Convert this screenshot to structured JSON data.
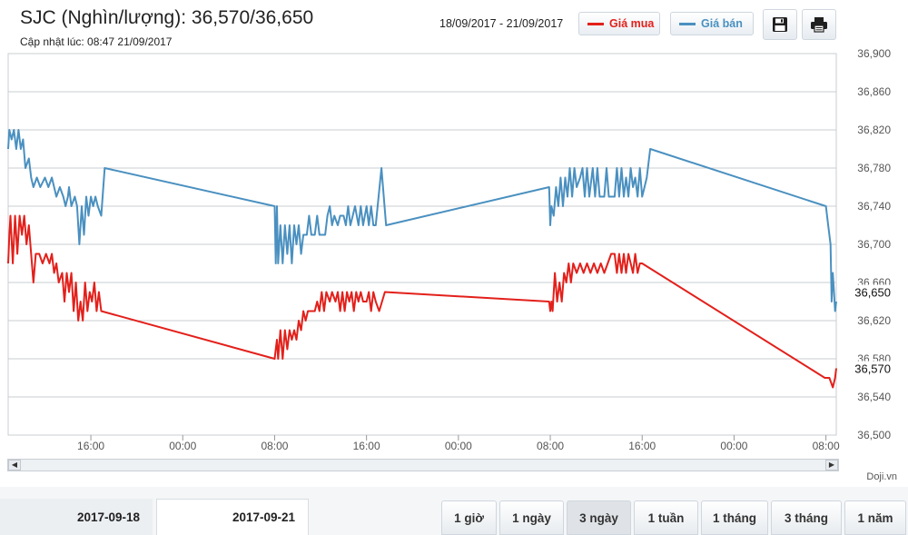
{
  "header": {
    "title": "SJC (Nghìn/lượng): 36,570/36,650",
    "updated": "Cập nhật lúc: 08:47 21/09/2017",
    "range": "18/09/2017 - 21/09/2017",
    "legend_buy": "Giá mua",
    "legend_sell": "Giá bán",
    "save_icon": "save-icon",
    "print_icon": "print-icon"
  },
  "colors": {
    "buy": "#e3201b",
    "sell": "#4a90c0"
  },
  "footer": {
    "credit": "Doji.vn"
  },
  "tabs": {
    "date1": "2017-09-18",
    "date2": "2017-09-21"
  },
  "ranges": [
    "1 giờ",
    "1 ngày",
    "3 ngày",
    "1 tuần",
    "1 tháng",
    "3 tháng",
    "1 năm"
  ],
  "active_range": "3 ngày",
  "chart_data": {
    "type": "line",
    "title": "",
    "xlabel": "",
    "ylabel": "",
    "ylim": [
      36500,
      36900
    ],
    "yticks": [
      "36,900",
      "36,860",
      "36,820",
      "36,780",
      "36,740",
      "36,700",
      "36,660",
      "36,620",
      "36,580",
      "36,540",
      "36,500"
    ],
    "xticks": [
      {
        "label": "16:00",
        "h": 16
      },
      {
        "label": "00:00",
        "h": 24
      },
      {
        "label": "08:00",
        "h": 32
      },
      {
        "label": "16:00",
        "h": 40
      },
      {
        "label": "00:00",
        "h": 48
      },
      {
        "label": "08:00",
        "h": 56
      },
      {
        "label": "16:00",
        "h": 64
      },
      {
        "label": "00:00",
        "h": 72
      },
      {
        "label": "08:00",
        "h": 80
      }
    ],
    "xrange_hours": [
      8.8,
      80.9
    ],
    "last_labels": [
      {
        "value": 36650,
        "text": "36,650"
      },
      {
        "value": 36570,
        "text": "36,570"
      }
    ],
    "series": [
      {
        "name": "Giá bán",
        "color": "#4a90c0",
        "points": [
          [
            8.8,
            36800
          ],
          [
            8.9,
            36820
          ],
          [
            9.1,
            36810
          ],
          [
            9.3,
            36820
          ],
          [
            9.5,
            36800
          ],
          [
            9.7,
            36820
          ],
          [
            9.9,
            36800
          ],
          [
            10.1,
            36810
          ],
          [
            10.3,
            36780
          ],
          [
            10.6,
            36790
          ],
          [
            10.8,
            36770
          ],
          [
            11.0,
            36760
          ],
          [
            11.3,
            36770
          ],
          [
            11.6,
            36760
          ],
          [
            12.0,
            36770
          ],
          [
            12.3,
            36760
          ],
          [
            12.6,
            36770
          ],
          [
            12.8,
            36760
          ],
          [
            13.0,
            36750
          ],
          [
            13.3,
            36760
          ],
          [
            13.6,
            36750
          ],
          [
            13.8,
            36740
          ],
          [
            14.0,
            36750
          ],
          [
            14.1,
            36760
          ],
          [
            14.3,
            36740
          ],
          [
            14.6,
            36750
          ],
          [
            14.8,
            36740
          ],
          [
            15.0,
            36700
          ],
          [
            15.2,
            36740
          ],
          [
            15.4,
            36710
          ],
          [
            15.6,
            36750
          ],
          [
            15.8,
            36730
          ],
          [
            16.0,
            36750
          ],
          [
            16.2,
            36740
          ],
          [
            16.4,
            36750
          ],
          [
            16.6,
            36740
          ],
          [
            16.9,
            36730
          ],
          [
            17.2,
            36780
          ],
          [
            32.0,
            36740
          ],
          [
            32.1,
            36680
          ],
          [
            32.2,
            36740
          ],
          [
            32.3,
            36680
          ],
          [
            32.5,
            36720
          ],
          [
            32.7,
            36680
          ],
          [
            32.9,
            36720
          ],
          [
            33.1,
            36690
          ],
          [
            33.3,
            36720
          ],
          [
            33.5,
            36680
          ],
          [
            33.7,
            36720
          ],
          [
            33.9,
            36700
          ],
          [
            34.1,
            36720
          ],
          [
            34.3,
            36690
          ],
          [
            34.5,
            36710
          ],
          [
            34.8,
            36710
          ],
          [
            35.0,
            36730
          ],
          [
            35.2,
            36710
          ],
          [
            35.5,
            36710
          ],
          [
            35.7,
            36730
          ],
          [
            35.9,
            36710
          ],
          [
            36.1,
            36710
          ],
          [
            36.4,
            36710
          ],
          [
            36.6,
            36730
          ],
          [
            36.8,
            36740
          ],
          [
            37.0,
            36720
          ],
          [
            37.2,
            36730
          ],
          [
            37.5,
            36720
          ],
          [
            37.7,
            36730
          ],
          [
            38.0,
            36730
          ],
          [
            38.2,
            36720
          ],
          [
            38.4,
            36740
          ],
          [
            38.6,
            36720
          ],
          [
            38.8,
            36730
          ],
          [
            39.0,
            36740
          ],
          [
            39.3,
            36720
          ],
          [
            39.5,
            36740
          ],
          [
            39.7,
            36720
          ],
          [
            40.0,
            36740
          ],
          [
            40.2,
            36720
          ],
          [
            40.4,
            36740
          ],
          [
            40.6,
            36720
          ],
          [
            40.8,
            36720
          ],
          [
            41.3,
            36780
          ],
          [
            41.7,
            36720
          ],
          [
            55.9,
            36760
          ],
          [
            56.0,
            36720
          ],
          [
            56.1,
            36740
          ],
          [
            56.3,
            36730
          ],
          [
            56.5,
            36760
          ],
          [
            56.7,
            36740
          ],
          [
            56.9,
            36770
          ],
          [
            57.1,
            36740
          ],
          [
            57.3,
            36770
          ],
          [
            57.5,
            36750
          ],
          [
            57.7,
            36780
          ],
          [
            57.9,
            36750
          ],
          [
            58.1,
            36780
          ],
          [
            58.3,
            36760
          ],
          [
            58.6,
            36770
          ],
          [
            58.8,
            36780
          ],
          [
            59.0,
            36750
          ],
          [
            59.2,
            36780
          ],
          [
            59.4,
            36750
          ],
          [
            59.7,
            36780
          ],
          [
            59.9,
            36750
          ],
          [
            60.1,
            36780
          ],
          [
            60.3,
            36750
          ],
          [
            60.5,
            36750
          ],
          [
            60.7,
            36750
          ],
          [
            60.9,
            36780
          ],
          [
            61.1,
            36750
          ],
          [
            61.3,
            36750
          ],
          [
            61.6,
            36750
          ],
          [
            61.8,
            36780
          ],
          [
            62.0,
            36750
          ],
          [
            62.2,
            36780
          ],
          [
            62.4,
            36750
          ],
          [
            62.6,
            36770
          ],
          [
            62.8,
            36750
          ],
          [
            63.0,
            36780
          ],
          [
            63.2,
            36760
          ],
          [
            63.4,
            36770
          ],
          [
            63.6,
            36750
          ],
          [
            63.8,
            36780
          ],
          [
            64.0,
            36750
          ],
          [
            64.2,
            36760
          ],
          [
            64.4,
            36770
          ],
          [
            64.7,
            36800
          ],
          [
            80.0,
            36740
          ],
          [
            80.2,
            36720
          ],
          [
            80.4,
            36700
          ],
          [
            80.5,
            36640
          ],
          [
            80.6,
            36670
          ],
          [
            80.7,
            36650
          ],
          [
            80.8,
            36630
          ],
          [
            80.9,
            36640
          ]
        ]
      },
      {
        "name": "Giá mua",
        "color": "#e3201b",
        "points": [
          [
            8.8,
            36680
          ],
          [
            8.9,
            36710
          ],
          [
            9.0,
            36730
          ],
          [
            9.2,
            36680
          ],
          [
            9.4,
            36730
          ],
          [
            9.6,
            36690
          ],
          [
            9.8,
            36730
          ],
          [
            10.0,
            36710
          ],
          [
            10.2,
            36730
          ],
          [
            10.4,
            36700
          ],
          [
            10.6,
            36720
          ],
          [
            10.8,
            36690
          ],
          [
            11.0,
            36660
          ],
          [
            11.2,
            36690
          ],
          [
            11.5,
            36690
          ],
          [
            11.8,
            36680
          ],
          [
            12.1,
            36690
          ],
          [
            12.4,
            36680
          ],
          [
            12.6,
            36690
          ],
          [
            12.8,
            36670
          ],
          [
            13.0,
            36680
          ],
          [
            13.2,
            36660
          ],
          [
            13.5,
            36670
          ],
          [
            13.7,
            36640
          ],
          [
            13.9,
            36670
          ],
          [
            14.1,
            36650
          ],
          [
            14.3,
            36670
          ],
          [
            14.5,
            36630
          ],
          [
            14.7,
            36660
          ],
          [
            14.9,
            36620
          ],
          [
            15.1,
            36640
          ],
          [
            15.3,
            36620
          ],
          [
            15.5,
            36660
          ],
          [
            15.7,
            36630
          ],
          [
            15.9,
            36650
          ],
          [
            16.1,
            36640
          ],
          [
            16.3,
            36660
          ],
          [
            16.5,
            36630
          ],
          [
            16.7,
            36650
          ],
          [
            16.9,
            36630
          ],
          [
            32.0,
            36580
          ],
          [
            32.1,
            36590
          ],
          [
            32.2,
            36600
          ],
          [
            32.3,
            36580
          ],
          [
            32.5,
            36610
          ],
          [
            32.7,
            36580
          ],
          [
            32.9,
            36610
          ],
          [
            33.1,
            36590
          ],
          [
            33.3,
            36610
          ],
          [
            33.5,
            36600
          ],
          [
            33.7,
            36610
          ],
          [
            33.9,
            36600
          ],
          [
            34.1,
            36620
          ],
          [
            34.3,
            36610
          ],
          [
            34.5,
            36630
          ],
          [
            34.7,
            36620
          ],
          [
            34.9,
            36630
          ],
          [
            35.2,
            36630
          ],
          [
            35.5,
            36630
          ],
          [
            35.7,
            36640
          ],
          [
            35.9,
            36630
          ],
          [
            36.1,
            36650
          ],
          [
            36.3,
            36630
          ],
          [
            36.5,
            36650
          ],
          [
            36.8,
            36640
          ],
          [
            37.0,
            36650
          ],
          [
            37.3,
            36640
          ],
          [
            37.5,
            36650
          ],
          [
            37.7,
            36630
          ],
          [
            37.9,
            36650
          ],
          [
            38.1,
            36630
          ],
          [
            38.3,
            36650
          ],
          [
            38.5,
            36640
          ],
          [
            38.7,
            36650
          ],
          [
            38.9,
            36630
          ],
          [
            39.1,
            36650
          ],
          [
            39.3,
            36640
          ],
          [
            39.5,
            36650
          ],
          [
            39.7,
            36640
          ],
          [
            40.0,
            36640
          ],
          [
            40.2,
            36650
          ],
          [
            40.4,
            36630
          ],
          [
            40.6,
            36650
          ],
          [
            40.8,
            36640
          ],
          [
            41.1,
            36630
          ],
          [
            41.6,
            36650
          ],
          [
            55.9,
            36640
          ],
          [
            56.0,
            36630
          ],
          [
            56.1,
            36640
          ],
          [
            56.2,
            36630
          ],
          [
            56.4,
            36670
          ],
          [
            56.6,
            36640
          ],
          [
            56.8,
            36660
          ],
          [
            57.0,
            36640
          ],
          [
            57.2,
            36670
          ],
          [
            57.4,
            36660
          ],
          [
            57.6,
            36680
          ],
          [
            57.8,
            36660
          ],
          [
            58.0,
            36680
          ],
          [
            58.3,
            36670
          ],
          [
            58.6,
            36680
          ],
          [
            58.9,
            36670
          ],
          [
            59.2,
            36680
          ],
          [
            59.5,
            36670
          ],
          [
            59.8,
            36680
          ],
          [
            60.1,
            36670
          ],
          [
            60.4,
            36680
          ],
          [
            60.7,
            36670
          ],
          [
            61.0,
            36680
          ],
          [
            61.3,
            36690
          ],
          [
            61.6,
            36690
          ],
          [
            61.8,
            36670
          ],
          [
            62.0,
            36690
          ],
          [
            62.2,
            36670
          ],
          [
            62.4,
            36690
          ],
          [
            62.6,
            36670
          ],
          [
            62.8,
            36690
          ],
          [
            63.0,
            36680
          ],
          [
            63.2,
            36670
          ],
          [
            63.4,
            36690
          ],
          [
            63.6,
            36670
          ],
          [
            63.8,
            36680
          ],
          [
            64.0,
            36680
          ],
          [
            79.9,
            36560
          ],
          [
            80.3,
            36560
          ],
          [
            80.6,
            36550
          ],
          [
            80.8,
            36560
          ],
          [
            80.9,
            36570
          ]
        ]
      }
    ]
  }
}
